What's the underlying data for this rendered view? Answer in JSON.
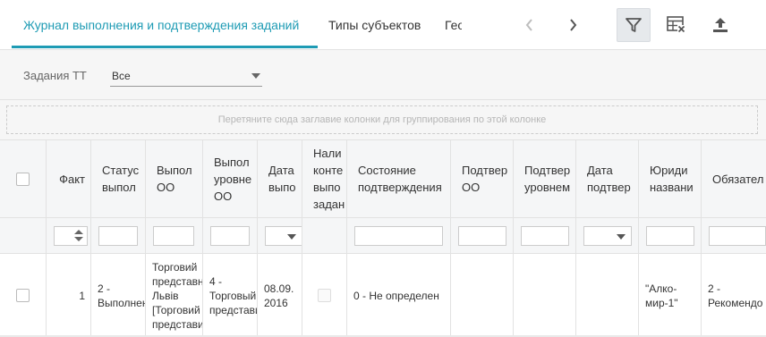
{
  "tabs": [
    {
      "label": "Журнал выполнения и подтверждения заданий",
      "active": true
    },
    {
      "label": "Типы субъектов",
      "active": false
    },
    {
      "label": "Гео",
      "active": false
    }
  ],
  "toolbar": {
    "prev_icon": "chevron-left-icon",
    "next_icon": "chevron-right-icon",
    "filter_icon": "filter-icon",
    "filter_active": true,
    "clear_table_icon": "table-clear-icon",
    "export_icon": "upload-icon"
  },
  "filters": {
    "tasks_label": "Задания ТТ",
    "tasks_value": "Все"
  },
  "group_panel": {
    "hint": "Перетяните сюда заглавие колонки для группирования по этой колонке"
  },
  "columns": [
    {
      "label": "Факт"
    },
    {
      "label": "Статус\nвыпол"
    },
    {
      "label": "Выпол\nОО"
    },
    {
      "label": "Выпол\nуровне\nОО"
    },
    {
      "label": "Дата\nвыпо"
    },
    {
      "label": "Нали\nконте\nвыпо\nзадан"
    },
    {
      "label": "Состояние\nподтверждения"
    },
    {
      "label": "Подтвер\nОО"
    },
    {
      "label": "Подтвер\nуровнем"
    },
    {
      "label": "Дата\nподтвер"
    },
    {
      "label": "Юриди\nназвани"
    },
    {
      "label": "Обязател"
    }
  ],
  "rows": [
    {
      "fact": "1",
      "status": "2 -\nВыполнен",
      "done_oo": "Торговий\nпредставн\nЛьвів\n[Торговий\nпредстави",
      "done_level": "4 -\nТорговый\nпредстави",
      "done_date": "08.09.\n2016",
      "has_control": false,
      "confirm_state": "0 - Не определен",
      "confirm_oo": "",
      "confirm_level": "",
      "confirm_date": "",
      "legal_name": "\"Алко-\nмир-1\"",
      "required": "2 -\nРекомендо"
    }
  ],
  "colors": {
    "accent": "#1e9bb4",
    "header_bg": "#f5f6f7",
    "border": "#e2e2e2"
  }
}
